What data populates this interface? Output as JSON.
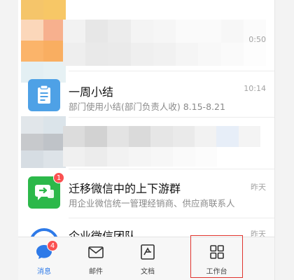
{
  "messages": [
    {
      "title": "",
      "subtitle": "",
      "time": "0:50",
      "blurred": true
    },
    {
      "title": "一周小结",
      "subtitle": "部门使用小结(部门负责人收) 8.15-8.21",
      "time": "10:14",
      "icon": "clipboard-icon",
      "icon_bg": "#4ea1e6"
    },
    {
      "title": "",
      "subtitle": "",
      "time": "",
      "blurred": true
    },
    {
      "title": "迁移微信中的上下游群",
      "subtitle": "用企业微信统一管理经销商、供应商联系人",
      "time": "昨天",
      "icon": "chat-transfer-icon",
      "icon_bg": "#2cb84a",
      "badge": "1"
    },
    {
      "title": "企业微信团队",
      "subtitle": "",
      "time": "昨天",
      "icon": "team-icon",
      "icon_bg": "#2e7ae8"
    }
  ],
  "tabbar": {
    "tabs": [
      {
        "label": "消息",
        "icon": "message-icon",
        "badge": "4",
        "active": true
      },
      {
        "label": "邮件",
        "icon": "mail-icon"
      },
      {
        "label": "文档",
        "icon": "document-icon"
      },
      {
        "label": "工作台",
        "icon": "workbench-grid-icon"
      }
    ]
  },
  "colors": {
    "accent": "#2e7ae8",
    "badge": "#fa5151",
    "highlight": "#e0342e"
  }
}
